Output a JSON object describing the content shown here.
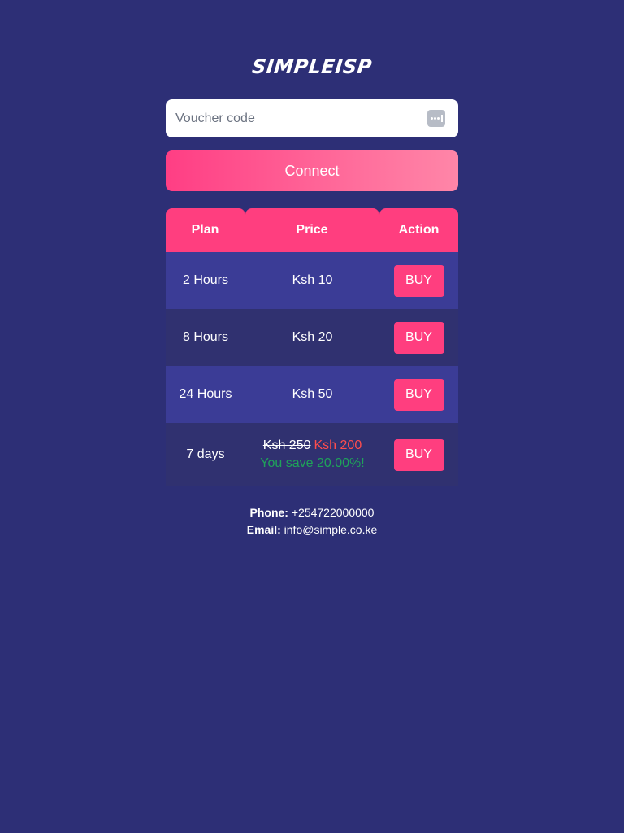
{
  "brand": {
    "logo_text": "SIMPLEISP"
  },
  "voucher": {
    "placeholder": "Voucher code",
    "value": "",
    "icon": "keyboard-dots-icon"
  },
  "connect": {
    "label": "Connect"
  },
  "colors": {
    "background": "#2d2f76",
    "accent": "#ff3e7f",
    "row_odd": "#3b3c96",
    "row_even": "#303170",
    "discount": "#ff4d4d",
    "saving": "#1fa25a"
  },
  "plans": {
    "headers": {
      "plan": "Plan",
      "price": "Price",
      "action": "Action"
    },
    "rows": [
      {
        "plan": "2 Hours",
        "price": "Ksh 10",
        "action": "BUY"
      },
      {
        "plan": "8 Hours",
        "price": "Ksh 20",
        "action": "BUY"
      },
      {
        "plan": "24 Hours",
        "price": "Ksh 50",
        "action": "BUY"
      },
      {
        "plan": "7 days",
        "old_price": "Ksh 250",
        "new_price": "Ksh 200",
        "saving": "You save 20.00%!",
        "action": "BUY"
      }
    ]
  },
  "contact": {
    "phone_label": "Phone:",
    "phone": "+254722000000",
    "email_label": "Email:",
    "email": "info@simple.co.ke"
  }
}
